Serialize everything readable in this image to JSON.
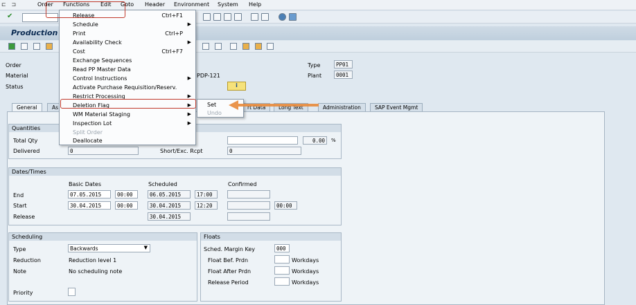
{
  "menubar": {
    "items": [
      "Order",
      "Functions",
      "Edit",
      "Goto",
      "Header",
      "Environment",
      "System",
      "Help"
    ]
  },
  "title": "Production",
  "header": {
    "order_label": "Order",
    "material_label": "Material",
    "status_label": "Status",
    "material_value_partial": "PDP-121",
    "type_label": "Type",
    "type_value": "PP01",
    "plant_label": "Plant",
    "plant_value": "0001"
  },
  "functions_menu": [
    {
      "label": "Release",
      "shortcut": "Ctrl+F1",
      "submenu": false,
      "disabled": false
    },
    {
      "label": "Schedule",
      "shortcut": "",
      "submenu": true,
      "disabled": false
    },
    {
      "label": "Print",
      "shortcut": "Ctrl+P",
      "submenu": false,
      "disabled": false
    },
    {
      "label": "Availability Check",
      "shortcut": "",
      "submenu": true,
      "disabled": false
    },
    {
      "label": "Cost",
      "shortcut": "Ctrl+F7",
      "submenu": false,
      "disabled": false
    },
    {
      "label": "Exchange Sequences",
      "shortcut": "",
      "submenu": false,
      "disabled": false
    },
    {
      "label": "Read PP Master Data",
      "shortcut": "",
      "submenu": false,
      "disabled": false
    },
    {
      "label": "Control Instructions",
      "shortcut": "",
      "submenu": true,
      "disabled": false
    },
    {
      "label": "Activate Purchase Requisition/Reserv.",
      "shortcut": "",
      "submenu": false,
      "disabled": false
    },
    {
      "label": "Restrict Processing",
      "shortcut": "",
      "submenu": true,
      "disabled": false
    },
    {
      "label": "Deletion Flag",
      "shortcut": "",
      "submenu": true,
      "disabled": false
    },
    {
      "label": "WM Material Staging",
      "shortcut": "",
      "submenu": true,
      "disabled": false
    },
    {
      "label": "Inspection Lot",
      "shortcut": "",
      "submenu": true,
      "disabled": false
    },
    {
      "label": "Split Order",
      "shortcut": "",
      "submenu": false,
      "disabled": true
    },
    {
      "label": "Deallocate",
      "shortcut": "",
      "submenu": false,
      "disabled": false
    }
  ],
  "deletion_submenu": {
    "set": "Set",
    "undo": "Undo"
  },
  "tabs": [
    "General",
    "As",
    "rt Data",
    "Long Text",
    "Administration",
    "SAP Event Mgmt"
  ],
  "quantities": {
    "title": "Quantities",
    "total_qty_label": "Total Qty",
    "delivered_label": "Delivered",
    "delivered_value": "0",
    "short_exc_label": "Short/Exc. Rcpt",
    "short_exc_value": "0",
    "pct_value": "0.00",
    "pct_unit": "%"
  },
  "dates": {
    "title": "Dates/Times",
    "col_basic": "Basic Dates",
    "col_scheduled": "Scheduled",
    "col_confirmed": "Confirmed",
    "end_label": "End",
    "start_label": "Start",
    "release_label": "Release",
    "end_basic": "07.05.2015",
    "end_basic_time": "00:00",
    "end_sched": "06.05.2015",
    "end_sched_time": "17:00",
    "start_basic": "30.04.2015",
    "start_basic_time": "00:00",
    "start_sched": "30.04.2015",
    "start_sched_time": "12:20",
    "start_conf_time": "00:00",
    "release_sched": "30.04.2015"
  },
  "scheduling": {
    "title": "Scheduling",
    "type_label": "Type",
    "type_value": "Backwards",
    "reduction_label": "Reduction",
    "reduction_value": "Reduction level 1",
    "note_label": "Note",
    "note_value": "No scheduling note",
    "priority_label": "Priority"
  },
  "floats": {
    "title": "Floats",
    "margin_key_label": "Sched. Margin Key",
    "margin_key_value": "000",
    "float_bef_label": "Float Bef. Prdn",
    "float_aft_label": "Float After Prdn",
    "release_period_label": "Release Period",
    "unit": "Workdays"
  },
  "colors": {
    "highlight": "#c0392b",
    "annotation_arrow": "#e8893a"
  }
}
